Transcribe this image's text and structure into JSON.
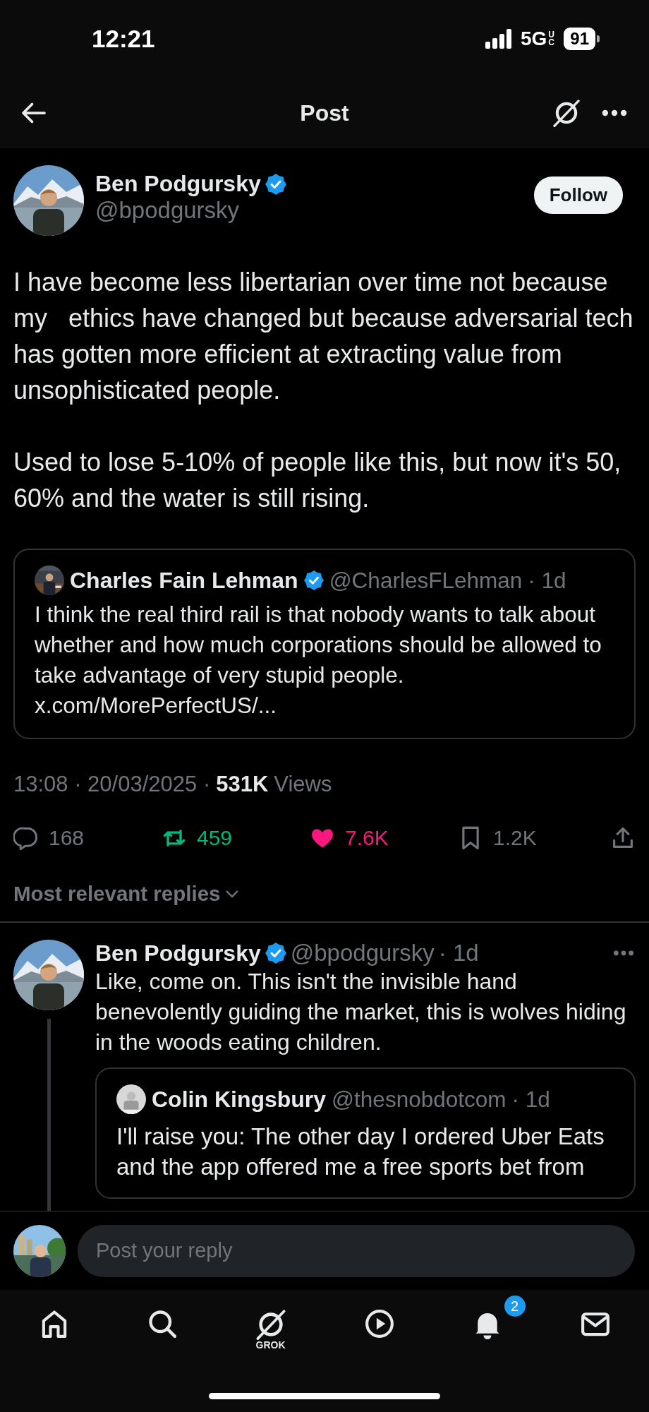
{
  "status_bar": {
    "time": "12:21",
    "network": "5G",
    "network_sub": "UC",
    "battery": "91"
  },
  "header": {
    "title": "Post"
  },
  "post": {
    "author": {
      "name": "Ben Podgursky",
      "verified": true,
      "handle": "@bpodgursky"
    },
    "follow_button": "Follow",
    "paragraphs": [
      "I have become less libertarian over time not because my   ethics have changed but because adversarial tech has gotten more efficient at extracting value from unsophisticated people.",
      "Used to lose 5-10% of people like this, but now it's 50, 60% and the water is still rising."
    ],
    "quote": {
      "name": "Charles Fain Lehman",
      "verified": true,
      "handle": "@CharlesFLehman",
      "time": "· 1d",
      "text": "I think the real third rail is that nobody wants to talk about whether and how much corporations should be allowed to take advantage of very stupid people.",
      "link": "x.com/MorePerfectUS/..."
    },
    "meta": {
      "timestamp": "13:08 · 20/03/2025 ·",
      "views_count": "531K",
      "views_label": "Views"
    },
    "actions": [
      {
        "kind": "reply",
        "count": "168"
      },
      {
        "kind": "repost",
        "count": "459",
        "active": true
      },
      {
        "kind": "like",
        "count": "7.6K",
        "active": true
      },
      {
        "kind": "bookmark",
        "count": "1.2K"
      },
      {
        "kind": "share"
      }
    ]
  },
  "replies_filter": {
    "label": "Most relevant replies"
  },
  "replies": [
    {
      "name": "Ben Podgursky",
      "verified": true,
      "handle": "@bpodgursky",
      "time": "· 1d",
      "text": "Like, come on.  This isn't the invisible hand benevolently guiding the market, this is wolves hiding in the woods eating children.",
      "thread": true,
      "quote": {
        "name": "Colin Kingsbury",
        "handle": "@thesnobdotcom",
        "time": "· 1d",
        "lines": [
          "I'll raise you: The other day I ordered Uber Eats",
          "and the app offered me a free sports bet from"
        ]
      }
    }
  ],
  "composer": {
    "placeholder": "Post your reply"
  },
  "nav": [
    {
      "kind": "home"
    },
    {
      "kind": "search"
    },
    {
      "kind": "grok",
      "label": "GROK"
    },
    {
      "kind": "video"
    },
    {
      "kind": "notifications",
      "badge": "2"
    },
    {
      "kind": "messages"
    }
  ]
}
